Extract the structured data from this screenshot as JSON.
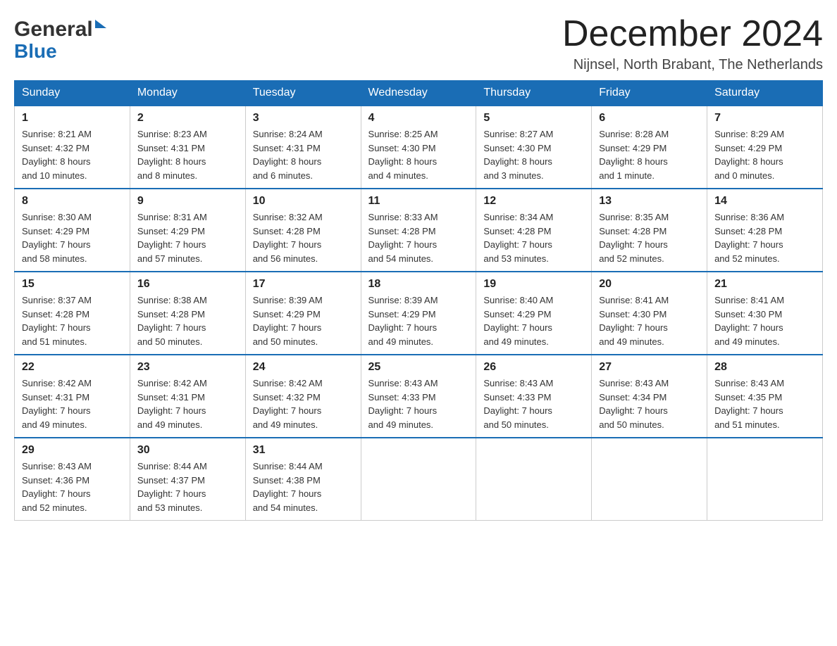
{
  "logo": {
    "general": "General",
    "blue": "Blue",
    "arrow_title": "GeneralBlue logo arrow"
  },
  "header": {
    "month_year": "December 2024",
    "location": "Nijnsel, North Brabant, The Netherlands"
  },
  "weekdays": [
    "Sunday",
    "Monday",
    "Tuesday",
    "Wednesday",
    "Thursday",
    "Friday",
    "Saturday"
  ],
  "weeks": [
    [
      {
        "day": "1",
        "sunrise": "8:21 AM",
        "sunset": "4:32 PM",
        "daylight": "8 hours and 10 minutes."
      },
      {
        "day": "2",
        "sunrise": "8:23 AM",
        "sunset": "4:31 PM",
        "daylight": "8 hours and 8 minutes."
      },
      {
        "day": "3",
        "sunrise": "8:24 AM",
        "sunset": "4:31 PM",
        "daylight": "8 hours and 6 minutes."
      },
      {
        "day": "4",
        "sunrise": "8:25 AM",
        "sunset": "4:30 PM",
        "daylight": "8 hours and 4 minutes."
      },
      {
        "day": "5",
        "sunrise": "8:27 AM",
        "sunset": "4:30 PM",
        "daylight": "8 hours and 3 minutes."
      },
      {
        "day": "6",
        "sunrise": "8:28 AM",
        "sunset": "4:29 PM",
        "daylight": "8 hours and 1 minute."
      },
      {
        "day": "7",
        "sunrise": "8:29 AM",
        "sunset": "4:29 PM",
        "daylight": "8 hours and 0 minutes."
      }
    ],
    [
      {
        "day": "8",
        "sunrise": "8:30 AM",
        "sunset": "4:29 PM",
        "daylight": "7 hours and 58 minutes."
      },
      {
        "day": "9",
        "sunrise": "8:31 AM",
        "sunset": "4:29 PM",
        "daylight": "7 hours and 57 minutes."
      },
      {
        "day": "10",
        "sunrise": "8:32 AM",
        "sunset": "4:28 PM",
        "daylight": "7 hours and 56 minutes."
      },
      {
        "day": "11",
        "sunrise": "8:33 AM",
        "sunset": "4:28 PM",
        "daylight": "7 hours and 54 minutes."
      },
      {
        "day": "12",
        "sunrise": "8:34 AM",
        "sunset": "4:28 PM",
        "daylight": "7 hours and 53 minutes."
      },
      {
        "day": "13",
        "sunrise": "8:35 AM",
        "sunset": "4:28 PM",
        "daylight": "7 hours and 52 minutes."
      },
      {
        "day": "14",
        "sunrise": "8:36 AM",
        "sunset": "4:28 PM",
        "daylight": "7 hours and 52 minutes."
      }
    ],
    [
      {
        "day": "15",
        "sunrise": "8:37 AM",
        "sunset": "4:28 PM",
        "daylight": "7 hours and 51 minutes."
      },
      {
        "day": "16",
        "sunrise": "8:38 AM",
        "sunset": "4:28 PM",
        "daylight": "7 hours and 50 minutes."
      },
      {
        "day": "17",
        "sunrise": "8:39 AM",
        "sunset": "4:29 PM",
        "daylight": "7 hours and 50 minutes."
      },
      {
        "day": "18",
        "sunrise": "8:39 AM",
        "sunset": "4:29 PM",
        "daylight": "7 hours and 49 minutes."
      },
      {
        "day": "19",
        "sunrise": "8:40 AM",
        "sunset": "4:29 PM",
        "daylight": "7 hours and 49 minutes."
      },
      {
        "day": "20",
        "sunrise": "8:41 AM",
        "sunset": "4:30 PM",
        "daylight": "7 hours and 49 minutes."
      },
      {
        "day": "21",
        "sunrise": "8:41 AM",
        "sunset": "4:30 PM",
        "daylight": "7 hours and 49 minutes."
      }
    ],
    [
      {
        "day": "22",
        "sunrise": "8:42 AM",
        "sunset": "4:31 PM",
        "daylight": "7 hours and 49 minutes."
      },
      {
        "day": "23",
        "sunrise": "8:42 AM",
        "sunset": "4:31 PM",
        "daylight": "7 hours and 49 minutes."
      },
      {
        "day": "24",
        "sunrise": "8:42 AM",
        "sunset": "4:32 PM",
        "daylight": "7 hours and 49 minutes."
      },
      {
        "day": "25",
        "sunrise": "8:43 AM",
        "sunset": "4:33 PM",
        "daylight": "7 hours and 49 minutes."
      },
      {
        "day": "26",
        "sunrise": "8:43 AM",
        "sunset": "4:33 PM",
        "daylight": "7 hours and 50 minutes."
      },
      {
        "day": "27",
        "sunrise": "8:43 AM",
        "sunset": "4:34 PM",
        "daylight": "7 hours and 50 minutes."
      },
      {
        "day": "28",
        "sunrise": "8:43 AM",
        "sunset": "4:35 PM",
        "daylight": "7 hours and 51 minutes."
      }
    ],
    [
      {
        "day": "29",
        "sunrise": "8:43 AM",
        "sunset": "4:36 PM",
        "daylight": "7 hours and 52 minutes."
      },
      {
        "day": "30",
        "sunrise": "8:44 AM",
        "sunset": "4:37 PM",
        "daylight": "7 hours and 53 minutes."
      },
      {
        "day": "31",
        "sunrise": "8:44 AM",
        "sunset": "4:38 PM",
        "daylight": "7 hours and 54 minutes."
      },
      null,
      null,
      null,
      null
    ]
  ],
  "labels": {
    "sunrise": "Sunrise:",
    "sunset": "Sunset:",
    "daylight": "Daylight:"
  }
}
